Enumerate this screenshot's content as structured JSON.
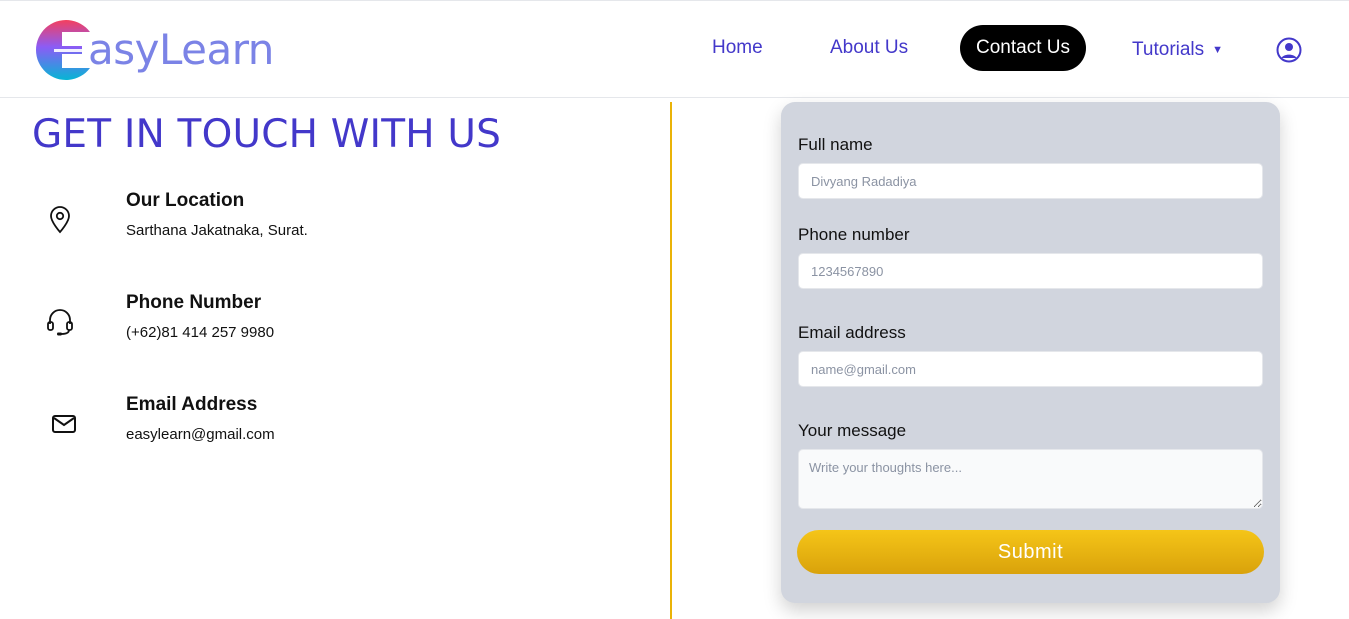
{
  "brand": {
    "name": "asyLearn",
    "logo_letter": "E"
  },
  "nav": {
    "items": [
      {
        "label": "Home"
      },
      {
        "label": "About Us"
      },
      {
        "label": "Contact Us"
      },
      {
        "label": "Tutorials"
      }
    ],
    "active": "Contact Us",
    "user_icon": "user-circle-icon"
  },
  "contact": {
    "heading": "GET IN TOUCH WITH US",
    "items": [
      {
        "icon": "location-pin-icon",
        "title": "Our Location",
        "value": "Sarthana Jakatnaka, Surat."
      },
      {
        "icon": "headset-icon",
        "title": "Phone Number",
        "value": "(+62)81 414 257 9980"
      },
      {
        "icon": "mail-icon",
        "title": "Email Address",
        "value": "easylearn@gmail.com"
      }
    ]
  },
  "form": {
    "full_name": {
      "label": "Full name",
      "placeholder": "Divyang Radadiya",
      "value": ""
    },
    "phone": {
      "label": "Phone number",
      "placeholder": "1234567890",
      "value": ""
    },
    "email": {
      "label": "Email address",
      "placeholder": "name@gmail.com",
      "value": ""
    },
    "message": {
      "label": "Your message",
      "placeholder": "Write your thoughts here...",
      "value": ""
    },
    "submit_label": "Submit"
  },
  "colors": {
    "brand_primary": "#4338ca",
    "accent_yellow": "#eab308",
    "card_bg": "#d1d5de",
    "active_nav_bg": "#000000"
  }
}
